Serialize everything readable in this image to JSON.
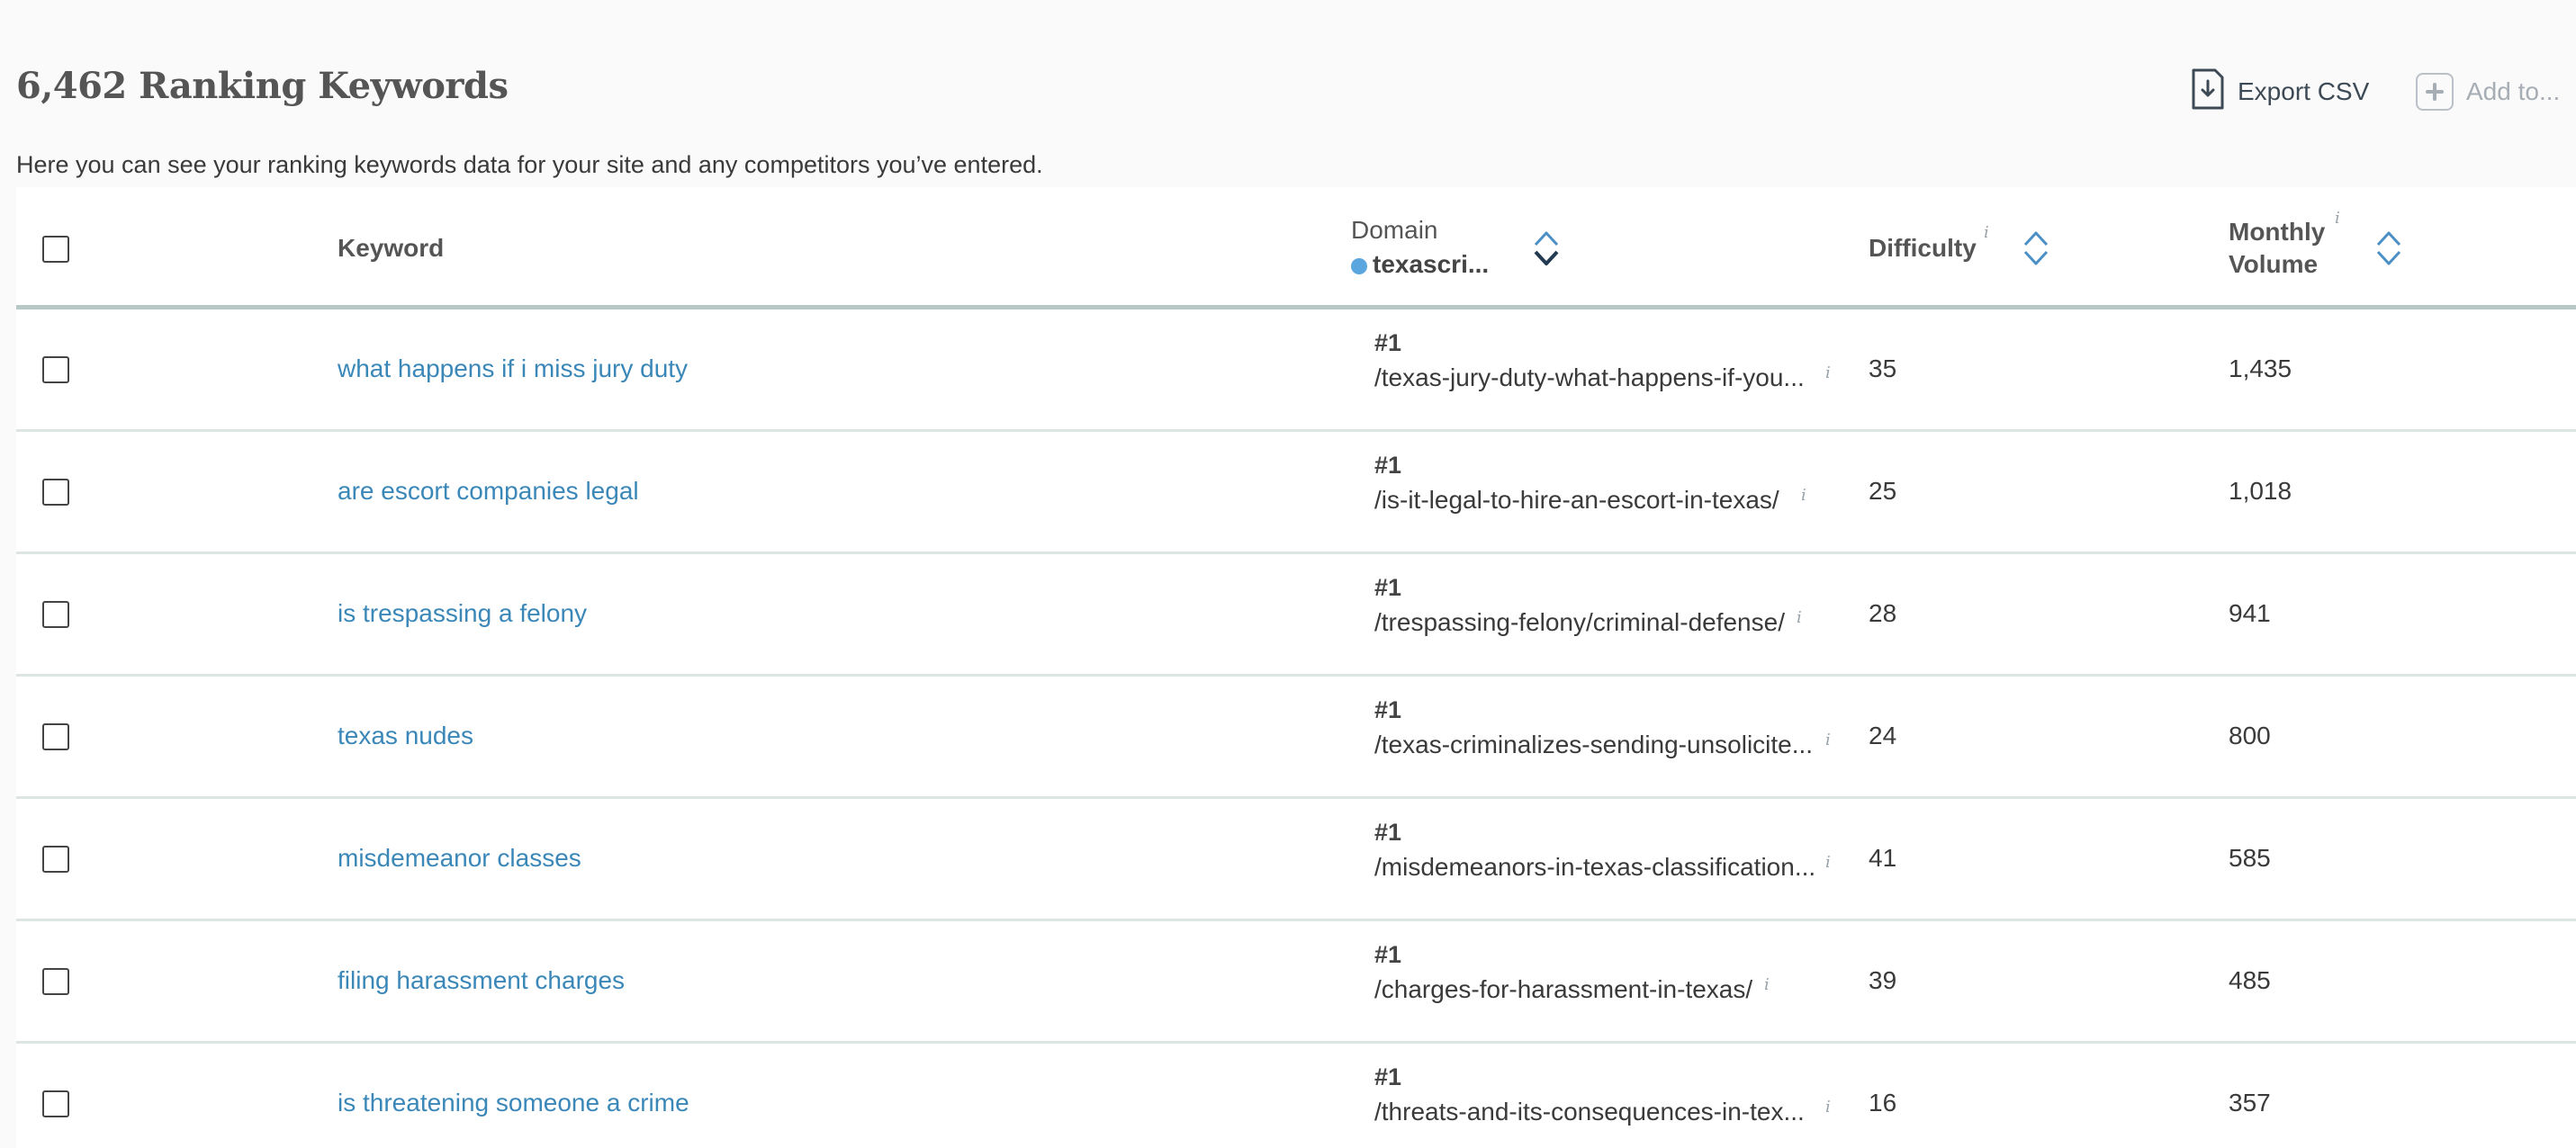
{
  "header": {
    "title": "6,462 Ranking Keywords",
    "subtitle": "Here you can see your ranking keywords data for your site and any competitors you’ve entered.",
    "export_label": "Export CSV",
    "add_to_label": "Add to..."
  },
  "table": {
    "columns": {
      "keyword": "Keyword",
      "domain": "Domain",
      "domain_name": "texascri...",
      "difficulty": "Difficulty",
      "monthly_line1": "Monthly",
      "monthly_line2": "Volume",
      "info_glyph": "i"
    },
    "rows": [
      {
        "keyword": "what happens if i miss jury duty",
        "rank": "#1",
        "url": "/texas-jury-duty-what-happens-if-you...",
        "difficulty": "35",
        "volume": "1,435"
      },
      {
        "keyword": "are escort companies legal",
        "rank": "#1",
        "url": "/is-it-legal-to-hire-an-escort-in-texas/",
        "difficulty": "25",
        "volume": "1,018"
      },
      {
        "keyword": "is trespassing a felony",
        "rank": "#1",
        "url": "/trespassing-felony/criminal-defense/",
        "difficulty": "28",
        "volume": "941"
      },
      {
        "keyword": "texas nudes",
        "rank": "#1",
        "url": "/texas-criminalizes-sending-unsolicite...",
        "difficulty": "24",
        "volume": "800"
      },
      {
        "keyword": "misdemeanor classes",
        "rank": "#1",
        "url": "/misdemeanors-in-texas-classification...",
        "difficulty": "41",
        "volume": "585"
      },
      {
        "keyword": "filing harassment charges",
        "rank": "#1",
        "url": "/charges-for-harassment-in-texas/",
        "difficulty": "39",
        "volume": "485"
      },
      {
        "keyword": "is threatening someone a crime",
        "rank": "#1",
        "url": "/threats-and-its-consequences-in-tex...",
        "difficulty": "16",
        "volume": "357"
      }
    ]
  },
  "colors": {
    "link": "#3a87b8",
    "domain_dot": "#5aa7df",
    "sort_icon": "#4a90c6"
  },
  "icons": [
    "export-csv-icon",
    "add-to-plus-icon",
    "sort-icon",
    "info-icon",
    "checkbox"
  ]
}
